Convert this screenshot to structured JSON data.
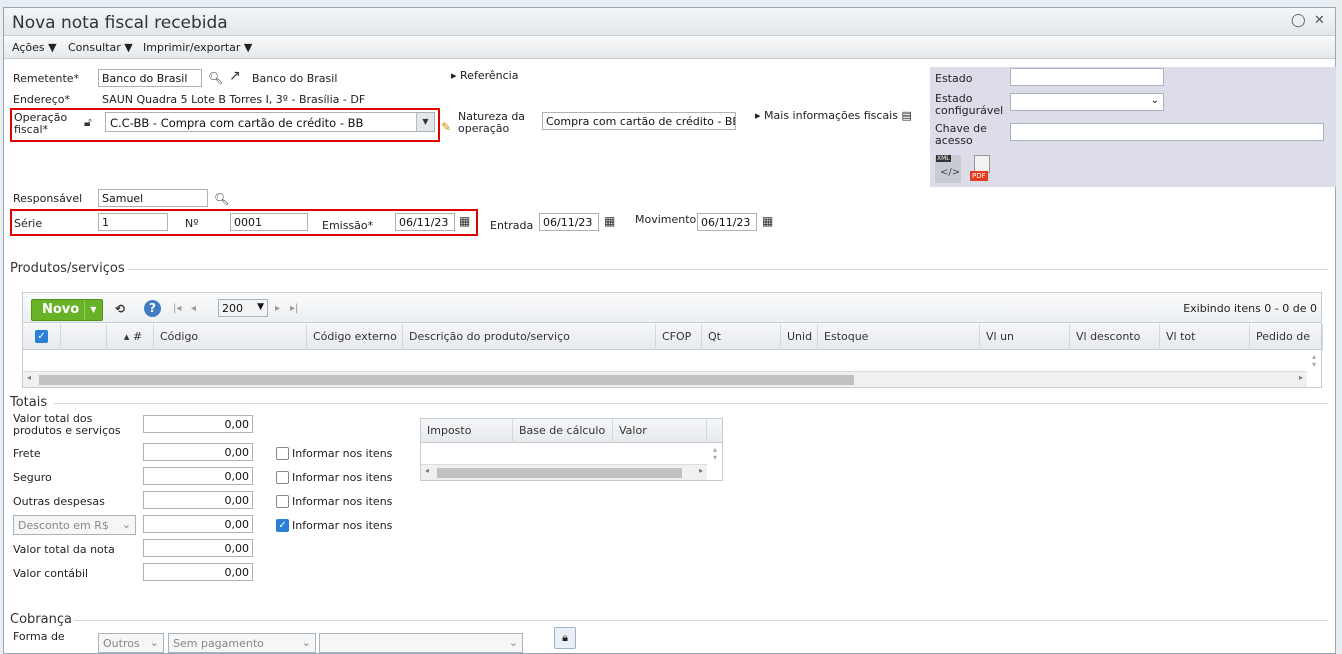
{
  "window": {
    "title": "Nova nota fiscal recebida",
    "chat_icon": "◯",
    "close_icon": "✕"
  },
  "menu": {
    "acoes": "Ações",
    "consultar": "Consultar",
    "imprimir": "Imprimir/exportar"
  },
  "form": {
    "remetente_label": "Remetente*",
    "remetente_value": "Banco do Brasil",
    "remetente_link": "Banco do Brasil",
    "referencia": "Referência",
    "endereco_label": "Endereço*",
    "endereco_value": "SAUN Quadra 5 Lote B Torres I, 3º - Brasília - DF",
    "operacao_label": "Operação fiscal*",
    "operacao_value": "C.C-BB - Compra com cartão de crédito - BB",
    "natureza_label": "Natureza da operação",
    "natureza_value": "Compra com cartão de crédito - BB",
    "mais_info": "Mais informações fiscais",
    "responsavel_label": "Responsável",
    "responsavel_value": "Samuel",
    "serie_label": "Série",
    "serie_value": "1",
    "numero_label": "Nº",
    "numero_value": "0001",
    "emissao_label": "Emissão*",
    "emissao_value": "06/11/23",
    "entrada_label": "Entrada",
    "entrada_value": "06/11/23",
    "movimento_label": "Movimento",
    "movimento_value": "06/11/23"
  },
  "side": {
    "estado_label": "Estado",
    "estado_config_label": "Estado configurável",
    "chave_label": "Chave de acesso",
    "xml_label": "XML",
    "pdf_label": "PDF"
  },
  "produtos": {
    "section": "Produtos/serviços",
    "novo": "Novo",
    "page_size": "200",
    "status": "Exibindo itens 0 - 0 de 0",
    "columns": [
      "#",
      "Código",
      "Código externo",
      "Descrição do produto/serviço",
      "CFOP",
      "Qt",
      "Unid",
      "Estoque",
      "Vl un",
      "Vl desconto",
      "Vl tot",
      "Pedido de"
    ]
  },
  "totais": {
    "section": "Totais",
    "valor_total_label": "Valor total dos produtos e serviços",
    "valor_total": "0,00",
    "frete_label": "Frete",
    "frete": "0,00",
    "seguro_label": "Seguro",
    "seguro": "0,00",
    "outras_label": "Outras despesas",
    "outras": "0,00",
    "desconto_select": "Desconto em R$",
    "desconto": "0,00",
    "valor_nota_label": "Valor total da nota",
    "valor_nota": "0,00",
    "valor_contabil_label": "Valor contábil",
    "valor_contabil": "0,00",
    "informar": "Informar nos itens",
    "imposto_cols": [
      "Imposto",
      "Base de cálculo",
      "Valor"
    ]
  },
  "cobranca": {
    "section": "Cobrança",
    "forma_label": "Forma de",
    "outros": "Outros",
    "sem_pagamento": "Sem pagamento"
  }
}
